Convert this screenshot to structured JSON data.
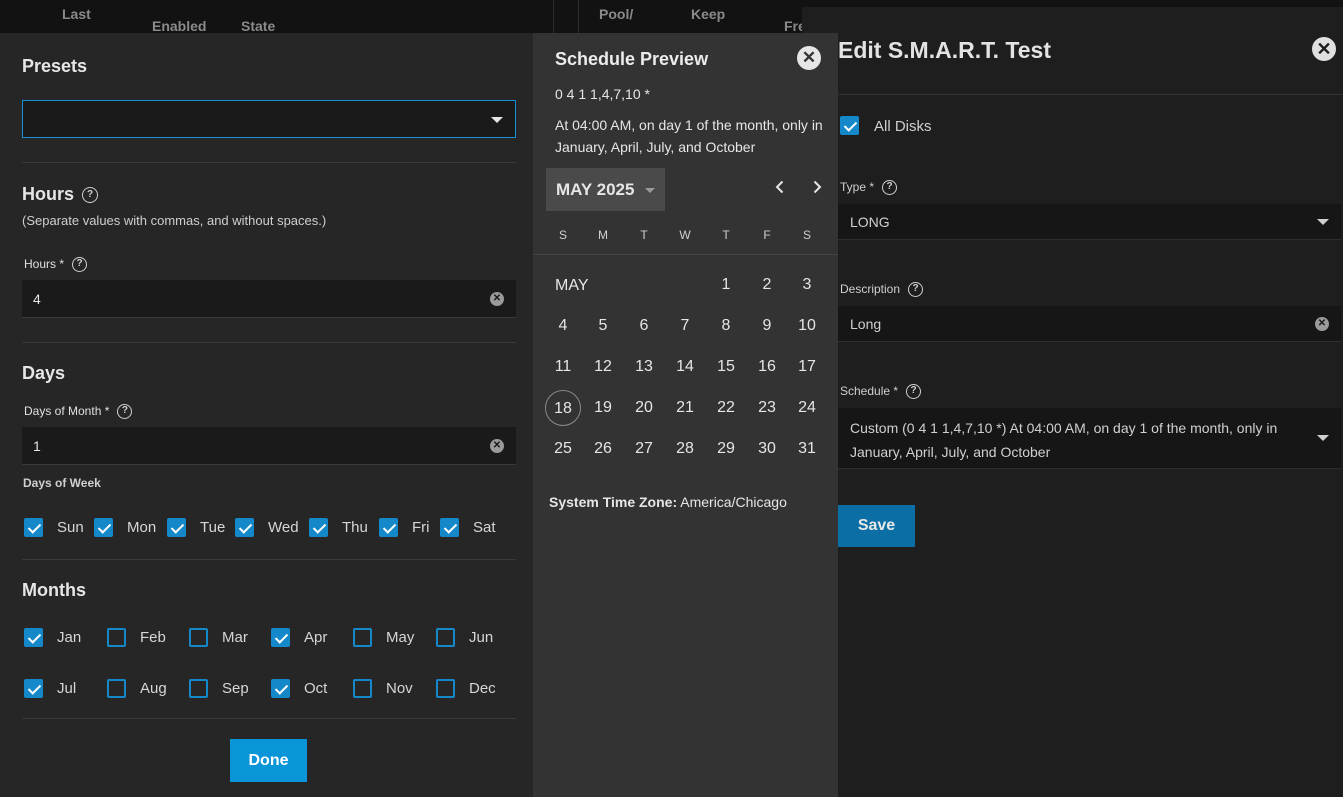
{
  "background_table": {
    "headers": [
      "Last",
      "Enabled",
      "State",
      "Pool/",
      "Keep",
      "Fre"
    ]
  },
  "edit_panel": {
    "title": "Edit S.M.A.R.T. Test",
    "all_disks_label": "All Disks",
    "type_label": "Type *",
    "type_value": "LONG",
    "description_label": "Description",
    "description_value": "Long",
    "schedule_label": "Schedule *",
    "schedule_value": "Custom (0 4 1 1,4,7,10 *) At 04:00 AM, on day 1 of the month, only in January, April, July, and October",
    "save_label": "Save"
  },
  "scheduler": {
    "presets_title": "Presets",
    "preset_value": "",
    "hours_title": "Hours",
    "hours_hint": "(Separate values with commas, and without spaces.)",
    "hours_label": "Hours *",
    "hours_value": "4",
    "days_title": "Days",
    "days_of_month_label": "Days of Month *",
    "days_of_month_value": "1",
    "days_of_week_label": "Days of Week",
    "weekdays": [
      {
        "label": "Sun",
        "checked": true
      },
      {
        "label": "Mon",
        "checked": true
      },
      {
        "label": "Tue",
        "checked": true
      },
      {
        "label": "Wed",
        "checked": true
      },
      {
        "label": "Thu",
        "checked": true
      },
      {
        "label": "Fri",
        "checked": true
      },
      {
        "label": "Sat",
        "checked": true
      }
    ],
    "months_title": "Months",
    "months": [
      {
        "label": "Jan",
        "checked": true
      },
      {
        "label": "Feb",
        "checked": false
      },
      {
        "label": "Mar",
        "checked": false
      },
      {
        "label": "Apr",
        "checked": true
      },
      {
        "label": "May",
        "checked": false
      },
      {
        "label": "Jun",
        "checked": false
      },
      {
        "label": "Jul",
        "checked": true
      },
      {
        "label": "Aug",
        "checked": false
      },
      {
        "label": "Sep",
        "checked": false
      },
      {
        "label": "Oct",
        "checked": true
      },
      {
        "label": "Nov",
        "checked": false
      },
      {
        "label": "Dec",
        "checked": false
      }
    ],
    "done_label": "Done"
  },
  "preview": {
    "title": "Schedule Preview",
    "cron": "0 4 1 1,4,7,10 *",
    "description": "At 04:00 AM, on day 1 of the month, only in January, April, July, and October",
    "month_button": "MAY 2025",
    "dow": [
      "S",
      "M",
      "T",
      "W",
      "T",
      "F",
      "S"
    ],
    "month_label": "MAY",
    "days": [
      1,
      2,
      3,
      4,
      5,
      6,
      7,
      8,
      9,
      10,
      11,
      12,
      13,
      14,
      15,
      16,
      17,
      18,
      19,
      20,
      21,
      22,
      23,
      24,
      25,
      26,
      27,
      28,
      29,
      30,
      31
    ],
    "first_weekday": 4,
    "today": 18,
    "timezone_label": "System Time Zone:",
    "timezone_value": "America/Chicago"
  },
  "colors": {
    "accent": "#1488c8",
    "done_button": "#0a95d8",
    "save_button": "#0b6fa6"
  }
}
